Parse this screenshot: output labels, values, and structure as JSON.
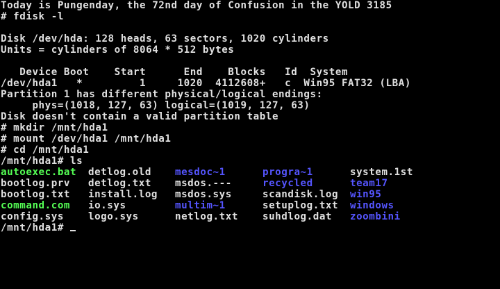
{
  "colors": {
    "background": "#000000",
    "text": "#e0e0e0",
    "executable": "#55ff55",
    "directory": "#5555ff"
  },
  "terminal": {
    "lines": [
      "Today is Pungenday, the 72nd day of Confusion in the YOLD 3185",
      "# fdisk -l",
      "",
      "Disk /dev/hda: 128 heads, 63 sectors, 1020 cylinders",
      "Units = cylinders of 8064 * 512 bytes",
      "",
      "   Device Boot    Start      End    Blocks   Id  System",
      "/dev/hda1   *         1     1020  4112608+   c  Win95 FAT32 (LBA)",
      "Partition 1 has different physical/logical endings:",
      "     phys=(1018, 127, 63) logical=(1019, 127, 63)",
      "Disk doesn't contain a valid partition table",
      "# mkdir /mnt/hda1",
      "# mount /dev/hda1 /mnt/hda1",
      "# cd /mnt/hda1",
      "/mnt/hda1# ls"
    ],
    "ls_rows": [
      [
        {
          "name": "autoexec.bat",
          "type": "exe"
        },
        {
          "name": "detlog.old",
          "type": "plain"
        },
        {
          "name": "mesdoc~1",
          "type": "dir"
        },
        {
          "name": "progra~1",
          "type": "dir"
        },
        {
          "name": "system.1st",
          "type": "plain"
        }
      ],
      [
        {
          "name": "bootlog.prv",
          "type": "plain"
        },
        {
          "name": "detlog.txt",
          "type": "plain"
        },
        {
          "name": "msdos.---",
          "type": "plain"
        },
        {
          "name": "recycled",
          "type": "dir"
        },
        {
          "name": "team17",
          "type": "dir"
        }
      ],
      [
        {
          "name": "bootlog.txt",
          "type": "plain"
        },
        {
          "name": "install.log",
          "type": "plain"
        },
        {
          "name": "msdos.sys",
          "type": "plain"
        },
        {
          "name": "scandisk.log",
          "type": "plain"
        },
        {
          "name": "win95",
          "type": "dir"
        }
      ],
      [
        {
          "name": "command.com",
          "type": "exe"
        },
        {
          "name": "io.sys",
          "type": "plain"
        },
        {
          "name": "multim~1",
          "type": "dir"
        },
        {
          "name": "setuplog.txt",
          "type": "plain"
        },
        {
          "name": "windows",
          "type": "dir"
        }
      ],
      [
        {
          "name": "config.sys",
          "type": "plain"
        },
        {
          "name": "logo.sys",
          "type": "plain"
        },
        {
          "name": "netlog.txt",
          "type": "plain"
        },
        {
          "name": "suhdlog.dat",
          "type": "plain"
        },
        {
          "name": "zoombini",
          "type": "dir"
        }
      ]
    ],
    "prompt": "/mnt/hda1#"
  }
}
